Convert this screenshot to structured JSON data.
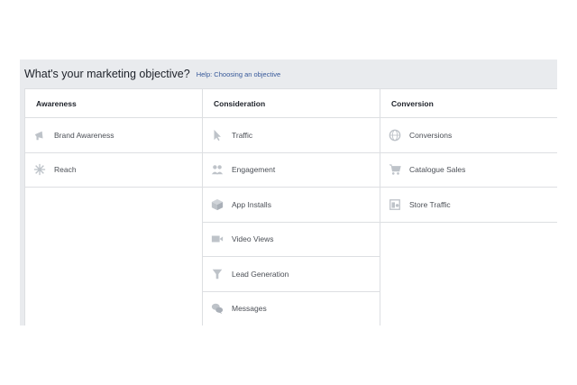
{
  "header": {
    "title": "What's your marketing objective?",
    "help_link": "Help: Choosing an objective"
  },
  "columns": [
    {
      "heading": "Awareness",
      "items": [
        {
          "label": "Brand Awareness",
          "icon": "megaphone-icon"
        },
        {
          "label": "Reach",
          "icon": "reach-icon"
        }
      ]
    },
    {
      "heading": "Consideration",
      "items": [
        {
          "label": "Traffic",
          "icon": "cursor-icon"
        },
        {
          "label": "Engagement",
          "icon": "people-icon"
        },
        {
          "label": "App Installs",
          "icon": "box-icon"
        },
        {
          "label": "Video Views",
          "icon": "video-camera-icon"
        },
        {
          "label": "Lead Generation",
          "icon": "funnel-icon"
        },
        {
          "label": "Messages",
          "icon": "chat-bubbles-icon"
        }
      ]
    },
    {
      "heading": "Conversion",
      "items": [
        {
          "label": "Conversions",
          "icon": "globe-icon"
        },
        {
          "label": "Catalogue Sales",
          "icon": "shopping-cart-icon"
        },
        {
          "label": "Store Traffic",
          "icon": "store-icon"
        }
      ]
    }
  ],
  "colors": {
    "panel_bg": "#e9ebee",
    "border": "#dddfe2",
    "icon": "#bec3c9",
    "link": "#365899"
  }
}
